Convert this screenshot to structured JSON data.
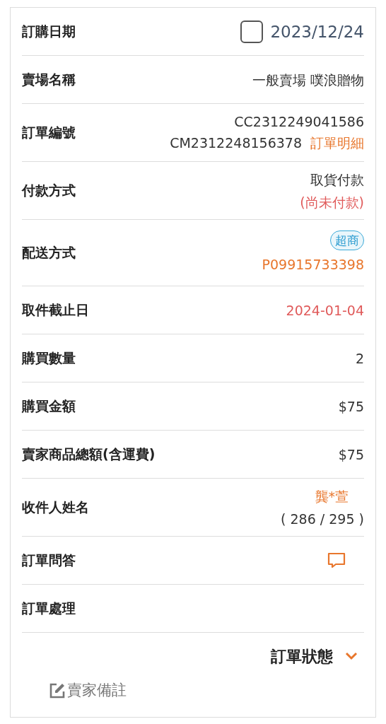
{
  "rows": [
    {
      "label": "訂購日期",
      "kind": "date",
      "checked": false,
      "value": "2023/12/24"
    },
    {
      "label": "賣場名稱",
      "kind": "text",
      "value": "一般賣場 噗浪贈物"
    },
    {
      "label": "訂單編號",
      "kind": "order_numbers",
      "numbers": [
        "CC2312249041586",
        "CM2312248156378"
      ],
      "link": "訂單明細"
    },
    {
      "label": "付款方式",
      "kind": "payment",
      "method": "取貨付款",
      "status": "(尚未付款)"
    },
    {
      "label": "配送方式",
      "kind": "shipping",
      "badge": "超商",
      "tracking": "P09915733398"
    },
    {
      "label": "取件截止日",
      "kind": "deadline",
      "value": "2024-01-04"
    },
    {
      "label": "購買數量",
      "kind": "text",
      "value": "2"
    },
    {
      "label": "購買金額",
      "kind": "text",
      "value": "$75"
    },
    {
      "label": "賣家商品總額(含運費)",
      "kind": "text",
      "value": "$75"
    },
    {
      "label": "收件人姓名",
      "kind": "recipient",
      "name": "龔*萱",
      "count": "( 286 / 295 )"
    },
    {
      "label": "訂單問答",
      "kind": "chat"
    },
    {
      "label": "訂單處理",
      "kind": "empty"
    }
  ],
  "status": {
    "label": "訂單狀態",
    "expanded": false
  },
  "remark": {
    "label": "賣家備註"
  }
}
